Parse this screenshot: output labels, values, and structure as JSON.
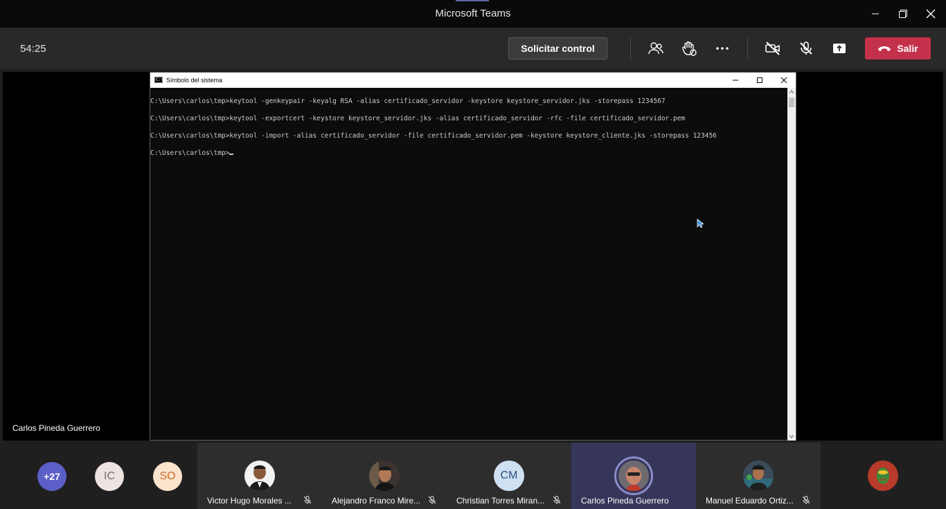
{
  "window": {
    "title": "Microsoft Teams"
  },
  "meeting": {
    "timer": "54:25",
    "request_control_label": "Solicitar control",
    "leave_label": "Salir",
    "toolbar_icons": [
      "people-icon",
      "raise-hand-icon",
      "more-options-icon",
      "camera-off-icon",
      "mic-off-icon",
      "share-tray-icon",
      "phone-hangup-icon"
    ],
    "leave_color": "#c4314b",
    "accent_color": "#6264a7"
  },
  "presenter": {
    "name": "Carlos Pineda Guerrero"
  },
  "console": {
    "title": "Símbolo del sistema",
    "lines": [
      "C:\\Users\\carlos\\tmp>keytool -genkeypair -keyalg RSA -alias certificado_servidor -keystore keystore_servidor.jks -storepass 1234567",
      "C:\\Users\\carlos\\tmp>keytool -exportcert -keystore keystore_servidor.jks -alias certificado_servidor -rfc -file certificado_servidor.pem",
      "C:\\Users\\carlos\\tmp>keytool -import -alias certificado_servidor -file certificado_servidor.pem -keystore keystore_cliente.jks -storepass 123456",
      "C:\\Users\\carlos\\tmp>"
    ]
  },
  "participants": {
    "overflow": "+27",
    "initials": [
      {
        "text": "IC",
        "color": "#ede3e0"
      },
      {
        "text": "SO",
        "color": "#fce4cc"
      }
    ],
    "tiles": [
      {
        "name": "Victor Hugo Morales ...",
        "muted": true
      },
      {
        "name": "Alejandro Franco Mire...",
        "muted": true
      },
      {
        "name": "Christian Torres Miran...",
        "initials": "CM",
        "muted": true
      },
      {
        "name": "Carlos Pineda Guerrero",
        "muted": false,
        "active": true
      },
      {
        "name": "Manuel Eduardo Ortiz...",
        "muted": true
      }
    ]
  }
}
